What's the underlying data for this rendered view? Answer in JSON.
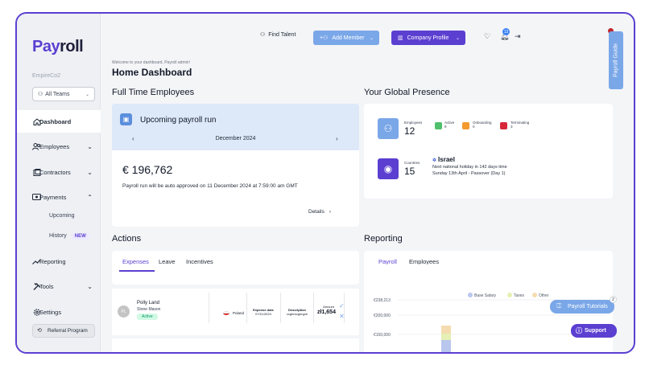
{
  "brand": {
    "logo_a": "Pay",
    "logo_b": "roll",
    "company": "EmpireCo2",
    "accent": "#5b3fd1"
  },
  "sidebar": {
    "teams": "All Teams",
    "items": [
      {
        "label": "Dashboard"
      },
      {
        "label": "Employees"
      },
      {
        "label": "Contractors"
      },
      {
        "label": "Payments"
      },
      {
        "label": "Reporting"
      },
      {
        "label": "Tools"
      },
      {
        "label": "Settings"
      }
    ],
    "payments_sub": [
      "Upcoming",
      "History"
    ],
    "new_badge": "NEW",
    "referral": "Referral Program"
  },
  "topbar": {
    "find_talent": "Find Talent",
    "add_member": "Add Member",
    "company_profile": "Company Profile",
    "notif_count": "13",
    "guide": "Payroll Guide"
  },
  "header": {
    "welcome": "Welcome to your dashboard, Payroll admin!",
    "title": "Home Dashboard"
  },
  "fte": {
    "title": "Full Time Employees",
    "payroll_title": "Upcoming payroll run",
    "month": "December 2024",
    "amount": "€ 196,762",
    "note": "Payroll run will be auto approved on 11 December 2024 at 7:59:00 am GMT",
    "details": "Details"
  },
  "global": {
    "title": "Your Global Presence",
    "employees_label": "Employees",
    "employees": "12",
    "active_label": "Active",
    "active": "9",
    "onboarding_label": "Onboarding",
    "onboarding": "0",
    "terminating_label": "Terminating",
    "terminating": "3",
    "countries_label": "Countries",
    "countries": "15",
    "country_name": "Israel",
    "holiday_line1": "Next national holiday in 142 days time",
    "holiday_line2": "Sunday 13th April - Passover (Day 1)"
  },
  "actions": {
    "title": "Actions",
    "tabs": [
      "Expenses",
      "Leave",
      "Incentives"
    ],
    "row": {
      "initials": "PL",
      "name": "Polly Land",
      "role": "Stone Mason",
      "status": "Active",
      "country": "Poland",
      "expense_date_label": "Expense date",
      "expense_date": "07/11/2024",
      "description_label": "Description",
      "description": "vcghrezgergve",
      "amount_label": "Amount",
      "amount": "zł1,654"
    }
  },
  "reporting": {
    "title": "Reporting",
    "tabs": [
      "Payroll",
      "Employees"
    ],
    "legend": [
      "Base Salary",
      "Taxes",
      "Other"
    ],
    "legend_colors": [
      "#b9c6ee",
      "#e6efb4",
      "#f5dcb0"
    ]
  },
  "chart_data": {
    "type": "bar",
    "series": [
      {
        "name": "Base Salary"
      },
      {
        "name": "Taxes"
      },
      {
        "name": "Other"
      }
    ],
    "y_ticks": [
      "€238,213",
      "€200,000",
      "€150,000"
    ]
  },
  "floating": {
    "tutorials": "Payroll Tutorials",
    "tutorials_count": "2",
    "support": "Support"
  }
}
